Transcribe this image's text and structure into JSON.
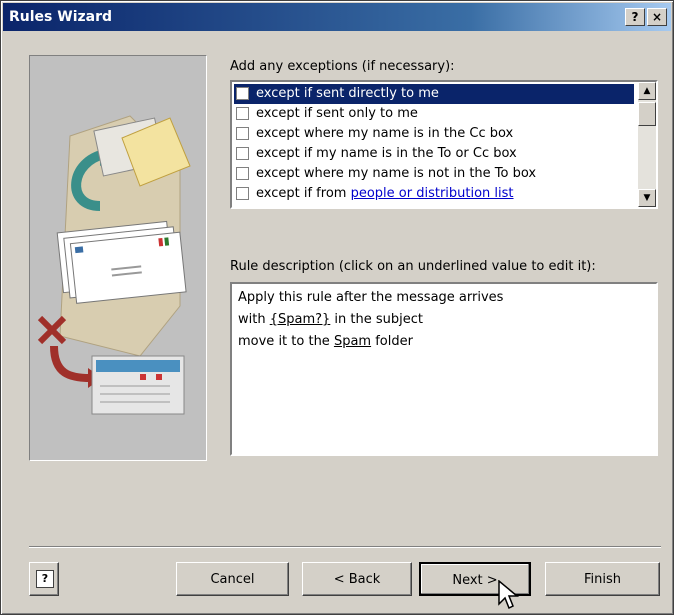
{
  "window": {
    "title": "Rules Wizard",
    "help_label": "?",
    "close_label": "×"
  },
  "exceptions": {
    "label": "Add any exceptions (if necessary):",
    "items": [
      {
        "text": "except if sent directly to me",
        "selected": true
      },
      {
        "text": "except if sent only to me",
        "selected": false
      },
      {
        "text": "except where my name is in the Cc box",
        "selected": false
      },
      {
        "text": "except if my name is in the To or Cc box",
        "selected": false
      },
      {
        "text": "except where my name is not in the To box",
        "selected": false
      },
      {
        "text_prefix": "except if from ",
        "link": "people or distribution list",
        "selected": false
      }
    ]
  },
  "description": {
    "label": "Rule description (click on an underlined value to edit it):",
    "line1": "Apply this rule after the message arrives",
    "line2_prefix": "with ",
    "line2_value": "{Spam?}",
    "line2_suffix": " in the subject",
    "line3_prefix": "move it to the ",
    "line3_value": "Spam",
    "line3_suffix": " folder"
  },
  "buttons": {
    "help": "?",
    "cancel": "Cancel",
    "back": "< Back",
    "next": "Next >",
    "finish": "Finish"
  },
  "colors": {
    "title_bar": "#0a246a",
    "selection": "#0a246a",
    "link": "#0000cc",
    "dialog_bg": "#d4d0c8"
  }
}
